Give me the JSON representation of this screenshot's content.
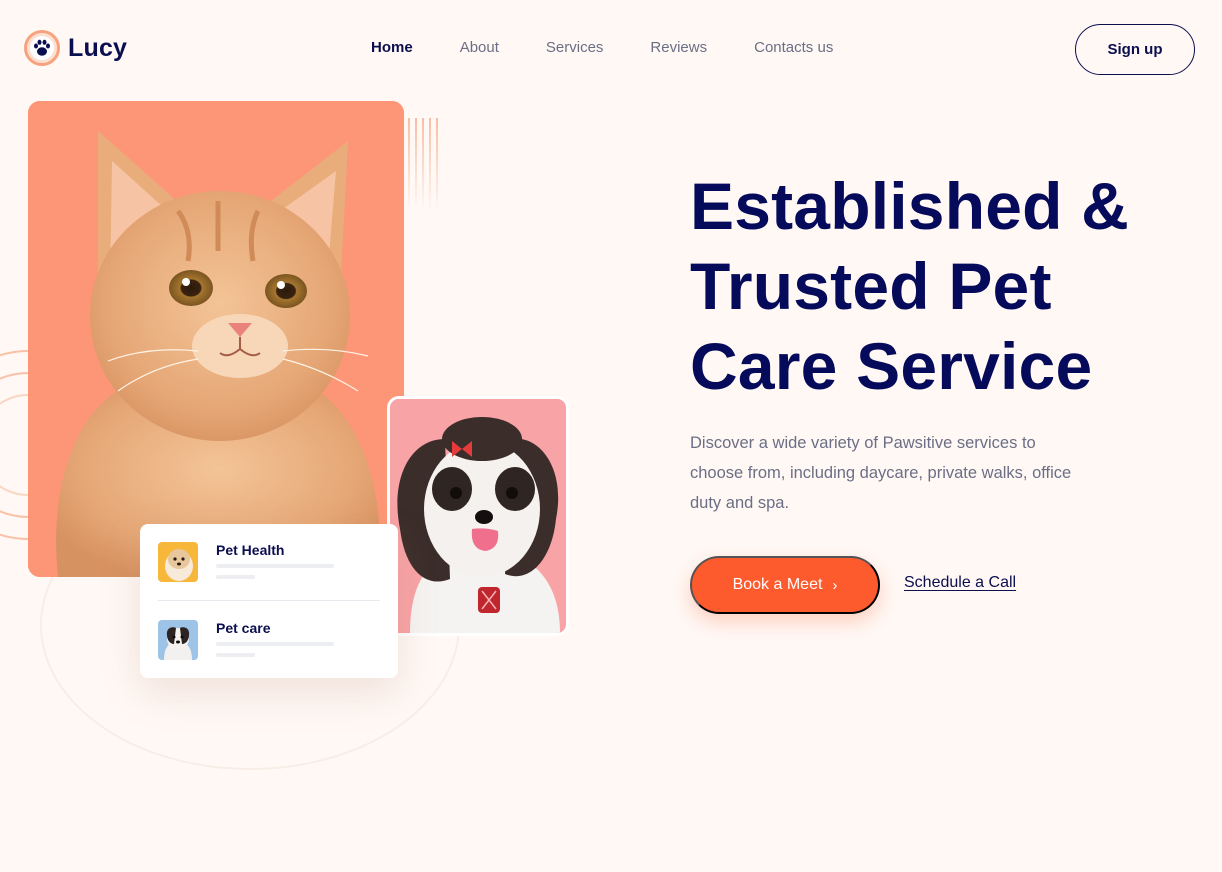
{
  "brand": {
    "name": "Lucy",
    "logo_icon": "paw-icon",
    "accent": "#fd5a2d",
    "dark": "#050a5a"
  },
  "nav": {
    "items": [
      {
        "label": "Home",
        "active": true
      },
      {
        "label": "About",
        "active": false
      },
      {
        "label": "Services",
        "active": false
      },
      {
        "label": "Reviews",
        "active": false
      },
      {
        "label": "Contacts us",
        "active": false
      }
    ],
    "signup_label": "Sign up"
  },
  "hero": {
    "title_lines": [
      "Established &",
      "Trusted Pet",
      "Care Service"
    ],
    "description": "Discover a wide variety of Pawsitive services to choose from, including daycare, private walks, office duty and spa.",
    "primary_cta": "Book a Meet",
    "primary_cta_icon": "chevron-right-icon",
    "secondary_cta": "Schedule a Call"
  },
  "services_card": {
    "items": [
      {
        "title": "Pet Health",
        "thumb": "puppy-photo"
      },
      {
        "title": "Pet care",
        "thumb": "dog-photo"
      }
    ]
  },
  "images": {
    "main": "kitten-photo",
    "secondary": "shih-tzu-photo"
  }
}
